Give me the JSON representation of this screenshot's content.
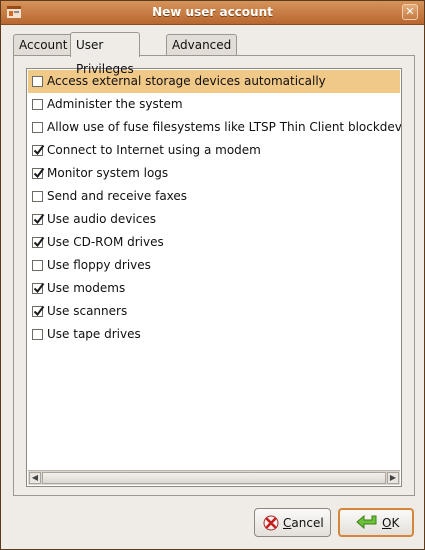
{
  "window": {
    "title": "New user account",
    "close_glyph": "✕"
  },
  "tabs": [
    {
      "label": "Account",
      "active": false
    },
    {
      "label": "User Privileges",
      "active": true
    },
    {
      "label": "Advanced",
      "active": false
    }
  ],
  "privileges": [
    {
      "label": "Access external storage devices automatically",
      "checked": false,
      "selected": true
    },
    {
      "label": "Administer the system",
      "checked": false
    },
    {
      "label": "Allow use of fuse filesystems like LTSP Thin Client blockdevice",
      "checked": false
    },
    {
      "label": "Connect to Internet using a modem",
      "checked": true
    },
    {
      "label": "Monitor system logs",
      "checked": true
    },
    {
      "label": "Send and receive faxes",
      "checked": false
    },
    {
      "label": "Use audio devices",
      "checked": true
    },
    {
      "label": "Use CD-ROM drives",
      "checked": true
    },
    {
      "label": "Use floppy drives",
      "checked": false
    },
    {
      "label": "Use modems",
      "checked": true
    },
    {
      "label": "Use scanners",
      "checked": true
    },
    {
      "label": "Use tape drives",
      "checked": false
    }
  ],
  "buttons": {
    "cancel": {
      "mnemonic": "C",
      "rest": "ancel",
      "icon": "cancel-icon"
    },
    "ok": {
      "mnemonic": "O",
      "rest": "K",
      "icon": "ok-arrow-icon"
    }
  },
  "colors": {
    "titlebar": "#c47a42",
    "selection": "#f0c887",
    "ok_border": "#d4863a"
  }
}
